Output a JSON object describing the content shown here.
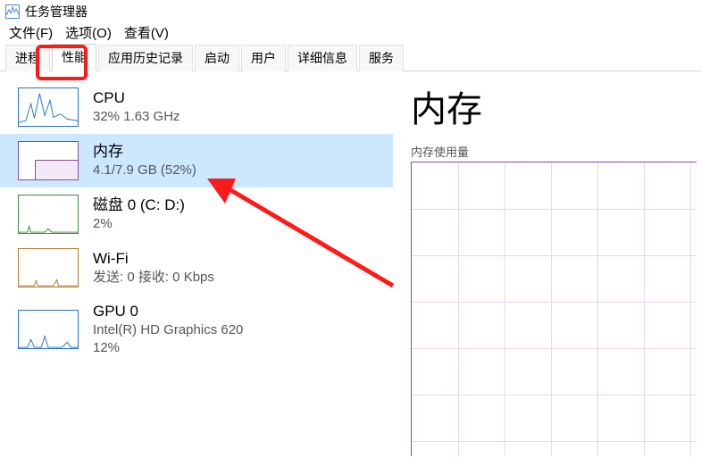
{
  "window": {
    "title": "任务管理器"
  },
  "menu": {
    "file": "文件(F)",
    "options": "选项(O)",
    "view": "查看(V)"
  },
  "tabs": {
    "processes": "进程",
    "performance": "性能",
    "app_history": "应用历史记录",
    "startup": "启动",
    "users": "用户",
    "details": "详细信息",
    "services": "服务"
  },
  "sidebar": {
    "cpu": {
      "name": "CPU",
      "detail": "32% 1.63 GHz"
    },
    "memory": {
      "name": "内存",
      "detail": "4.1/7.9 GB (52%)"
    },
    "disk": {
      "name": "磁盘 0 (C: D:)",
      "detail": "2%"
    },
    "wifi": {
      "name": "Wi-Fi",
      "detail": "发送: 0 接收: 0 Kbps"
    },
    "gpu": {
      "name": "GPU 0",
      "detail": "Intel(R) HD Graphics 620",
      "detail2": "12%"
    }
  },
  "detail": {
    "title": "内存",
    "subtitle": "内存使用量"
  },
  "chart_data": {
    "type": "line",
    "title": "内存使用量",
    "ylim": [
      0,
      7.9
    ],
    "series": [
      {
        "name": "内存使用量 (GB)",
        "values": [
          4.1
        ]
      }
    ],
    "note": "Only current value visible; rest of graph area is blank/off-screen in screenshot."
  }
}
